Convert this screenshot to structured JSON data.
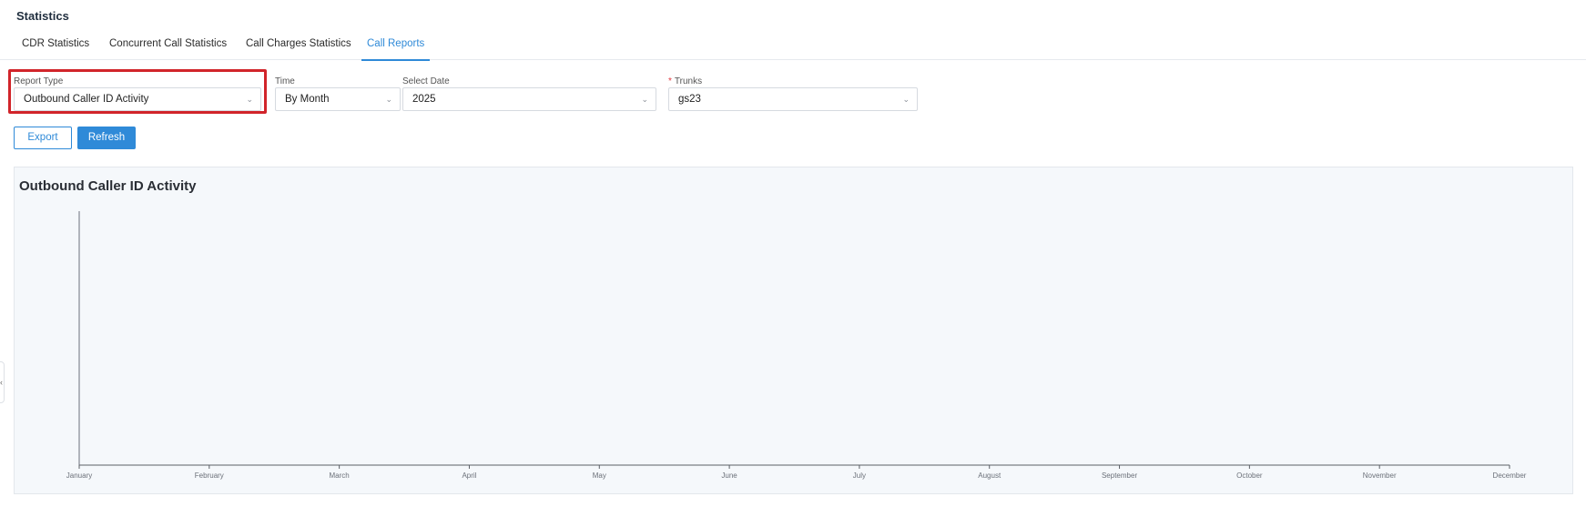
{
  "page": {
    "title": "Statistics"
  },
  "tabs": [
    {
      "label": "CDR Statistics"
    },
    {
      "label": "Concurrent Call Statistics"
    },
    {
      "label": "Call Charges Statistics"
    },
    {
      "label": "Call Reports"
    }
  ],
  "active_tab": "Call Reports",
  "filters": {
    "report_type": {
      "label": "Report Type",
      "value": "Outbound Caller ID Activity"
    },
    "time": {
      "label": "Time",
      "value": "By Month"
    },
    "select_date": {
      "label": "Select Date",
      "value": "2025"
    },
    "trunks": {
      "label": "Trunks",
      "required_mark": "*",
      "value": "gs23"
    }
  },
  "actions": {
    "export_label": "Export",
    "refresh_label": "Refresh"
  },
  "icons": {
    "dropdown": "chevron-down-icon",
    "side_handle": "chevron-left-icon"
  },
  "colors": {
    "accent": "#2f8ad8",
    "highlight": "#d1242a",
    "panel_bg": "#f5f8fb"
  },
  "chart_data": {
    "type": "bar",
    "title": "Outbound Caller ID Activity",
    "categories": [
      "January",
      "February",
      "March",
      "April",
      "May",
      "June",
      "July",
      "August",
      "September",
      "October",
      "November",
      "December"
    ],
    "series": [],
    "xlabel": "",
    "ylabel": "",
    "grid": false
  }
}
